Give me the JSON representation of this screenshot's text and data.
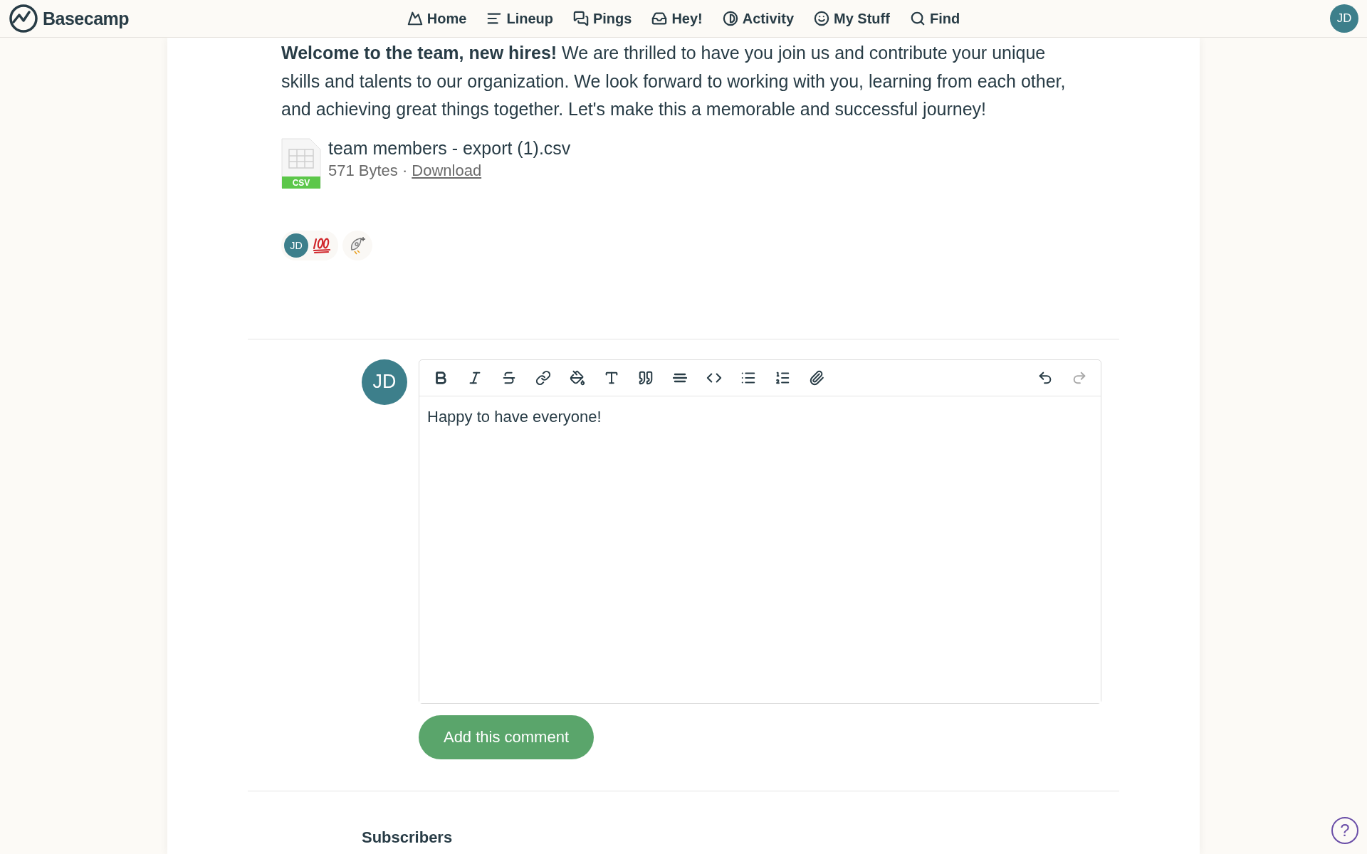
{
  "nav": {
    "brand": "Basecamp",
    "items": [
      {
        "kind": "home",
        "label": "Home"
      },
      {
        "kind": "lineup",
        "label": "Lineup"
      },
      {
        "kind": "pings",
        "label": "Pings"
      },
      {
        "kind": "hey",
        "label": "Hey!"
      },
      {
        "kind": "activity",
        "label": "Activity"
      },
      {
        "kind": "mystuff",
        "label": "My Stuff"
      },
      {
        "kind": "find",
        "label": "Find"
      }
    ],
    "user_initials": "JD"
  },
  "message": {
    "body": "**Welcome to the team, new hires!** We are thrilled to have you join us and contribute your unique skills and talents to our organization. We look forward to working with you, learning from each other, and achieving great things together. Let's make this a memorable and successful journey!",
    "attachment": {
      "type_label": "CSV",
      "name": "team members - export (1).csv",
      "size": "571 Bytes ·",
      "link": "Download"
    },
    "reactions": [
      {
        "initials": "JD",
        "kind": "hundred"
      }
    ]
  },
  "composer": {
    "initials": "JD",
    "tools": [
      {
        "kind": "bold",
        "disabled": false
      },
      {
        "kind": "italic",
        "disabled": false
      },
      {
        "kind": "strike",
        "disabled": false
      },
      {
        "kind": "link",
        "disabled": false
      },
      {
        "kind": "color",
        "disabled": false
      },
      {
        "kind": "size",
        "disabled": false
      },
      {
        "kind": "quote",
        "disabled": false
      },
      {
        "kind": "rule",
        "disabled": false
      },
      {
        "kind": "code",
        "disabled": false
      },
      {
        "kind": "bullets",
        "disabled": false
      },
      {
        "kind": "numbers",
        "disabled": false
      },
      {
        "kind": "attach",
        "disabled": false
      }
    ],
    "history": [
      {
        "kind": "undo",
        "disabled": false
      },
      {
        "kind": "redo",
        "disabled": true
      }
    ],
    "value": "Happy to have everyone!",
    "submit": "Add this comment"
  },
  "subscribers": {
    "heading": "Subscribers"
  },
  "help": "?"
}
